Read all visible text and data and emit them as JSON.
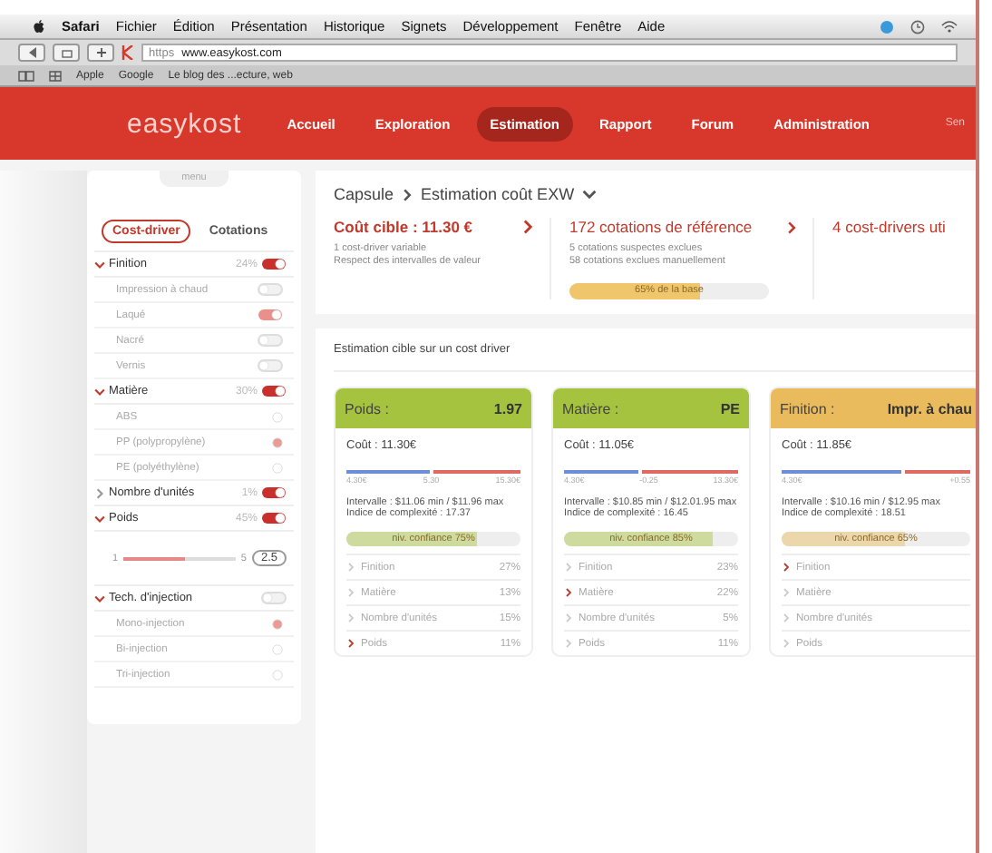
{
  "menubar": {
    "app": "Safari",
    "items": [
      "Fichier",
      "Édition",
      "Présentation",
      "Historique",
      "Signets",
      "Développement",
      "Fenêtre",
      "Aide"
    ]
  },
  "toolbar": {
    "scheme": "https",
    "url": "www.easykost.com"
  },
  "bookmarks": [
    "Apple",
    "Google",
    "Le blog des ...ecture, web"
  ],
  "header": {
    "logo": "easykost",
    "user": "Sen",
    "nav": [
      {
        "label": "Accueil",
        "selected": false
      },
      {
        "label": "Exploration",
        "selected": false
      },
      {
        "label": "Estimation",
        "selected": true
      },
      {
        "label": "Rapport",
        "selected": false
      },
      {
        "label": "Forum",
        "selected": false
      },
      {
        "label": "Administration",
        "selected": false
      }
    ]
  },
  "sidebar": {
    "handle": "menu",
    "tabs": [
      {
        "label": "Cost-driver",
        "selected": true
      },
      {
        "label": "Cotations",
        "selected": false
      }
    ],
    "items": [
      {
        "label": "Finition",
        "percent": "24%",
        "on": true,
        "expanded": true,
        "children": [
          {
            "kind": "toggle",
            "label": "Impression à chaud",
            "on": false
          },
          {
            "kind": "toggle",
            "label": "Laqué",
            "on": true
          },
          {
            "kind": "toggle",
            "label": "Nacré",
            "on": false
          },
          {
            "kind": "toggle",
            "label": "Vernis",
            "on": false
          }
        ]
      },
      {
        "label": "Matière",
        "percent": "30%",
        "on": true,
        "expanded": true,
        "children": [
          {
            "kind": "radio",
            "label": "ABS",
            "selected": false
          },
          {
            "kind": "radio",
            "label": "PP (polypropylène)",
            "selected": true
          },
          {
            "kind": "radio",
            "label": "PE (polyéthylène)",
            "selected": false
          }
        ]
      },
      {
        "label": "Nombre d'unités",
        "percent": "1%",
        "on": true,
        "expanded": false
      },
      {
        "label": "Poids",
        "percent": "45%",
        "on": true,
        "expanded": true,
        "children": [
          {
            "kind": "slider",
            "min": "1",
            "max": "5",
            "value": "2.5",
            "level": 0.55
          }
        ]
      },
      {
        "label": "Tech. d'injection",
        "on": false,
        "expanded": true,
        "children": [
          {
            "kind": "radio",
            "label": "Mono-injection",
            "selected": true
          },
          {
            "kind": "radio",
            "label": "Bi-injection",
            "selected": false
          },
          {
            "kind": "radio",
            "label": "Tri-injection",
            "selected": false
          }
        ]
      }
    ]
  },
  "breadcrumb": {
    "parent": "Capsule",
    "current": "Estimation coût EXW"
  },
  "summary": [
    {
      "kind": "target",
      "title": "Coût cible : 11.30 €",
      "lines": [
        "1 cost-driver variable",
        "Respect des intervalles de valeur"
      ]
    },
    {
      "kind": "quotes",
      "title": "172 cotations de référence",
      "lines": [
        "5 cotations suspectes exclues",
        "58 cotations exclues manuellement"
      ],
      "bar": {
        "label": "65% de la base",
        "level": 0.65
      }
    },
    {
      "kind": "drivers",
      "title": "4 cost-drivers uti"
    }
  ],
  "section_title": "Estimation cible sur un cost driver",
  "cards": [
    {
      "title": "Poids :",
      "value": "1.97",
      "color": "#a5c33f",
      "cost": "Coût : 11.30€",
      "range": [
        "4.30€",
        "5.30",
        "15.30€"
      ],
      "marker": {
        "level": 0.5
      },
      "interval": "Intervalle : $11.06 min / $11.96 max",
      "complexity": "Indice de complexité : 17.37",
      "confidence": {
        "label": "niv. confiance 75%",
        "level": 0.75
      },
      "rows": [
        {
          "label": "Finition",
          "value": "27%",
          "highlighted": false
        },
        {
          "label": "Matière",
          "value": "13%",
          "highlighted": false
        },
        {
          "label": "Nombre d'unités",
          "value": "15%",
          "highlighted": false
        },
        {
          "label": "Poids",
          "value": "11%",
          "highlighted": true
        }
      ]
    },
    {
      "title": "Matière :",
      "value": "PE",
      "color": "#a5c33f",
      "cost": "Coût : 11.05€",
      "range": [
        "4.30€",
        "-0.25",
        "13.30€"
      ],
      "marker": {
        "level": 0.45
      },
      "interval": "Intervalle : $10.85 min / $12.01.95 max",
      "complexity": "Indice de complexité : 16.45",
      "confidence": {
        "label": "niv. confiance 85%",
        "level": 0.85
      },
      "rows": [
        {
          "label": "Finition",
          "value": "23%",
          "highlighted": false
        },
        {
          "label": "Matière",
          "value": "22%",
          "highlighted": true
        },
        {
          "label": "Nombre d'unités",
          "value": "5%",
          "highlighted": false
        },
        {
          "label": "Poids",
          "value": "11%",
          "highlighted": false
        }
      ]
    },
    {
      "title": "Finition :",
      "value": "Impr. à chau",
      "color": "#e9bb5c",
      "cost": "Coût : 11.85€",
      "range": [
        "4.30€",
        "+0.55"
      ],
      "marker": {
        "level": 0.65
      },
      "interval": "Intervalle : $10.16 min / $12.95 max",
      "complexity": "Indice de complexité : 18.51",
      "confidence": {
        "label": "niv. confiance 65%",
        "level": 0.65
      },
      "rows": [
        {
          "label": "Finition",
          "highlighted": true
        },
        {
          "label": "Matière",
          "highlighted": false
        },
        {
          "label": "Nombre d'unités",
          "highlighted": false
        },
        {
          "label": "Poids",
          "highlighted": false
        }
      ]
    }
  ]
}
